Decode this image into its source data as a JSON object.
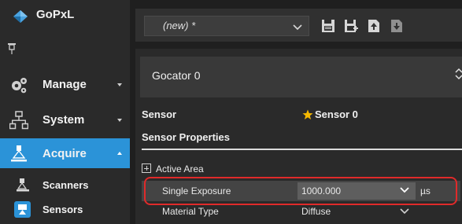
{
  "app": {
    "name": "GoPxL"
  },
  "sidebar": {
    "items": [
      {
        "label": "Manage",
        "icon": "gears-icon",
        "expanded": false
      },
      {
        "label": "System",
        "icon": "network-icon",
        "expanded": false
      },
      {
        "label": "Acquire",
        "icon": "scanner-icon",
        "expanded": true,
        "active": true
      }
    ],
    "subitems": [
      {
        "label": "Scanners",
        "icon": "scanner-head-icon"
      },
      {
        "label": "Sensors",
        "icon": "sensor-icon"
      }
    ]
  },
  "toolbar": {
    "job_value": "(new) *",
    "icons": [
      "save-icon",
      "save-as-icon",
      "load-icon",
      "download-icon"
    ]
  },
  "main": {
    "device_value": "Gocator 0",
    "sensor_label": "Sensor",
    "sensor_value": "Sensor 0",
    "section_title": "Sensor Properties",
    "rows": {
      "active_area": "Active Area",
      "single_exposure_label": "Single Exposure",
      "single_exposure_value": "1000.000",
      "single_exposure_unit": "µs",
      "material_type_label": "Material Type",
      "material_type_value": "Diffuse"
    }
  },
  "colors": {
    "accent": "#2b93d8",
    "highlight": "#e02a2a",
    "star": "#f5b800"
  }
}
